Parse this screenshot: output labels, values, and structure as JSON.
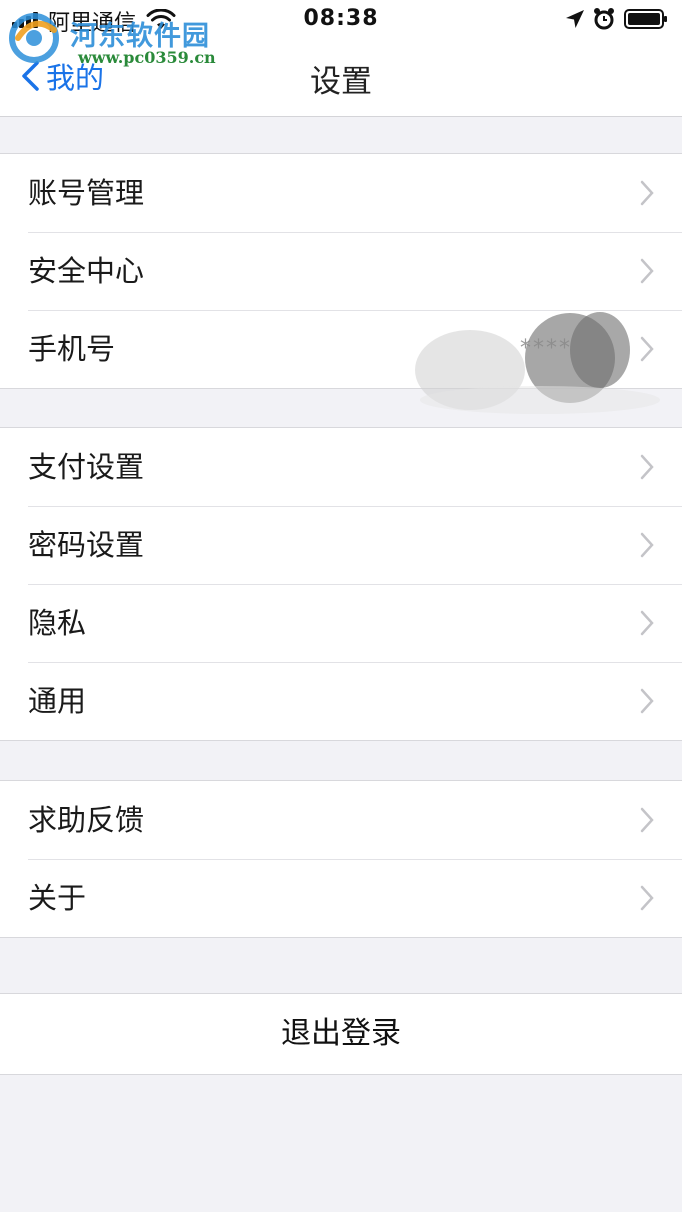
{
  "status_bar": {
    "carrier": "阿里通信",
    "time": "08:38"
  },
  "watermark": {
    "title": "河东软件园",
    "url": "www.pc0359.cn"
  },
  "nav": {
    "back_label": "我的",
    "title": "设置"
  },
  "group1": {
    "items": [
      {
        "label": "账号管理"
      },
      {
        "label": "安全中心"
      },
      {
        "label": "手机号",
        "value": "****"
      }
    ]
  },
  "group2": {
    "items": [
      {
        "label": "支付设置"
      },
      {
        "label": "密码设置"
      },
      {
        "label": "隐私"
      },
      {
        "label": "通用"
      }
    ]
  },
  "group3": {
    "items": [
      {
        "label": "求助反馈"
      },
      {
        "label": "关于"
      }
    ]
  },
  "logout": {
    "label": "退出登录"
  },
  "colors": {
    "accent": "#1a73e8",
    "background": "#f2f2f6",
    "cell": "#ffffff",
    "chevron": "#c4c4c8"
  },
  "icons": [
    "signal-icon",
    "wifi-icon",
    "location-icon",
    "alarm-icon",
    "battery-icon",
    "back-chevron-icon",
    "chevron-right-icon"
  ]
}
